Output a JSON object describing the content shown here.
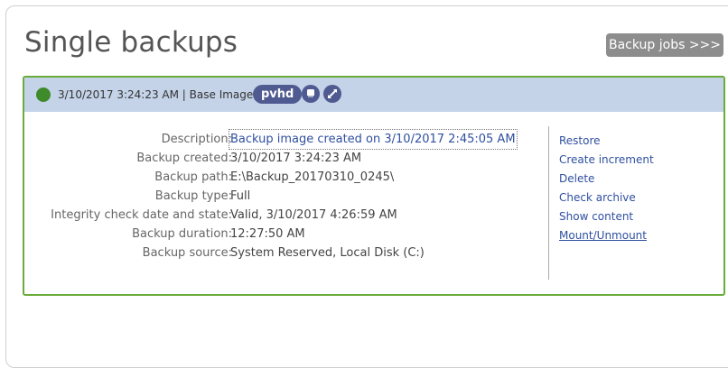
{
  "page": {
    "title": "Single backups"
  },
  "toolbar": {
    "jobs_label": "Backup jobs >>>"
  },
  "card": {
    "status_color": "#3f8a2a",
    "header_text": "3/10/2017 3:24:23 AM | Base Image",
    "format_badge": "pvhd",
    "icons": [
      "disk-icon",
      "expand-icon"
    ],
    "details": [
      {
        "label": "Description:",
        "value": "Backup image created on 3/10/2017 2:45:05 AM"
      },
      {
        "label": "Backup created:",
        "value": "3/10/2017 3:24:23 AM"
      },
      {
        "label": "Backup path:",
        "value": "E:\\Backup_20170310_0245\\"
      },
      {
        "label": "Backup type:",
        "value": "Full"
      },
      {
        "label": "Integrity check date and state:",
        "value": "Valid, 3/10/2017 4:26:59 AM"
      },
      {
        "label": "Backup duration:",
        "value": "12:27:50 AM"
      },
      {
        "label": "Backup source:",
        "value": "System Reserved, Local Disk (C:)"
      }
    ],
    "actions": [
      "Restore",
      "Create increment",
      "Delete",
      "Check archive",
      "Show content",
      "Mount/Unmount"
    ]
  },
  "colors": {
    "accent": "#6aab3b",
    "header_bg": "#c4d3e8",
    "badge": "#4f5a91",
    "link": "#2f4fa0"
  }
}
